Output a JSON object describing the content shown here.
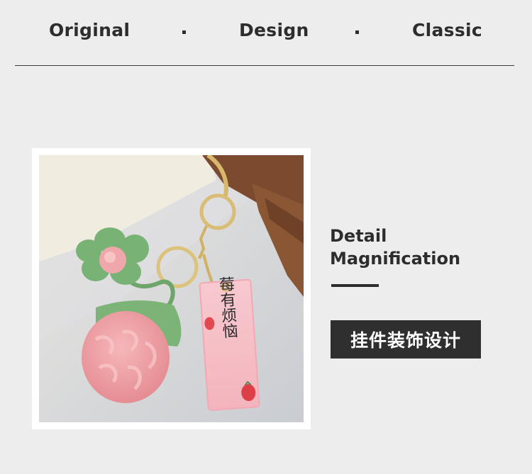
{
  "header": {
    "words": [
      "Original",
      "Design",
      "Classic"
    ],
    "separator": "·"
  },
  "detail": {
    "line1": "Detail",
    "line2": "Magnification",
    "badge": "挂件装饰设计"
  },
  "photo": {
    "tag_text": "莓有烦恼"
  }
}
